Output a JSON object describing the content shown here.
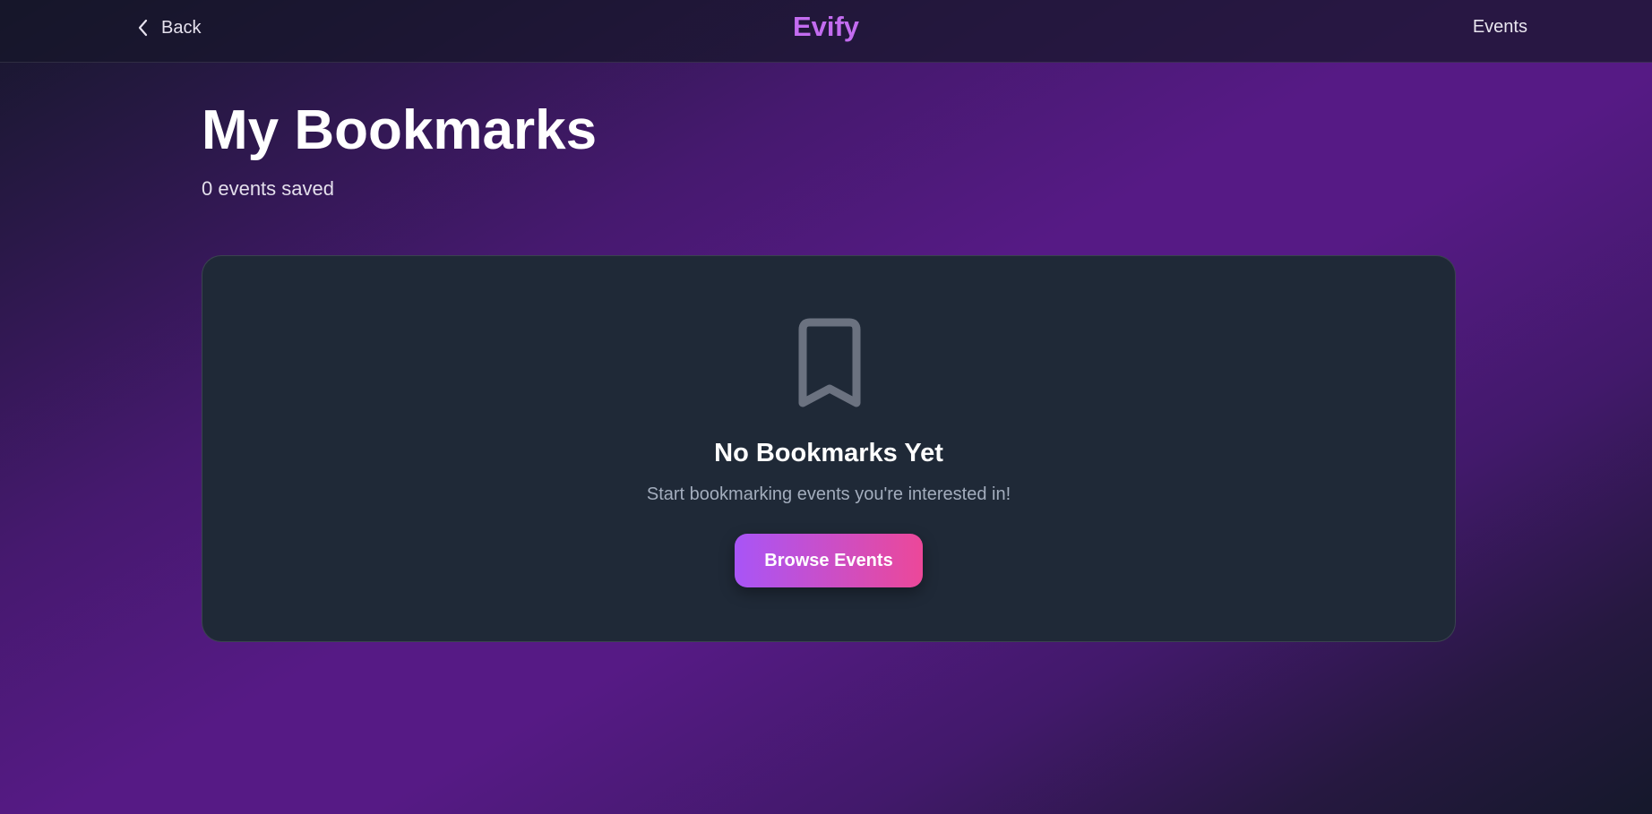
{
  "header": {
    "back_label": "Back",
    "brand": "Evify",
    "nav_events": "Events"
  },
  "page": {
    "title": "My Bookmarks",
    "saved_count": "0 events saved"
  },
  "empty_state": {
    "icon": "bookmark-icon",
    "title": "No Bookmarks Yet",
    "subtitle": "Start bookmarking events you're interested in!",
    "button_label": "Browse Events"
  },
  "colors": {
    "brand": "#c36cf0",
    "card_bg": "#1f2937",
    "button_gradient_start": "#a855f7",
    "button_gradient_end": "#ec4899"
  }
}
